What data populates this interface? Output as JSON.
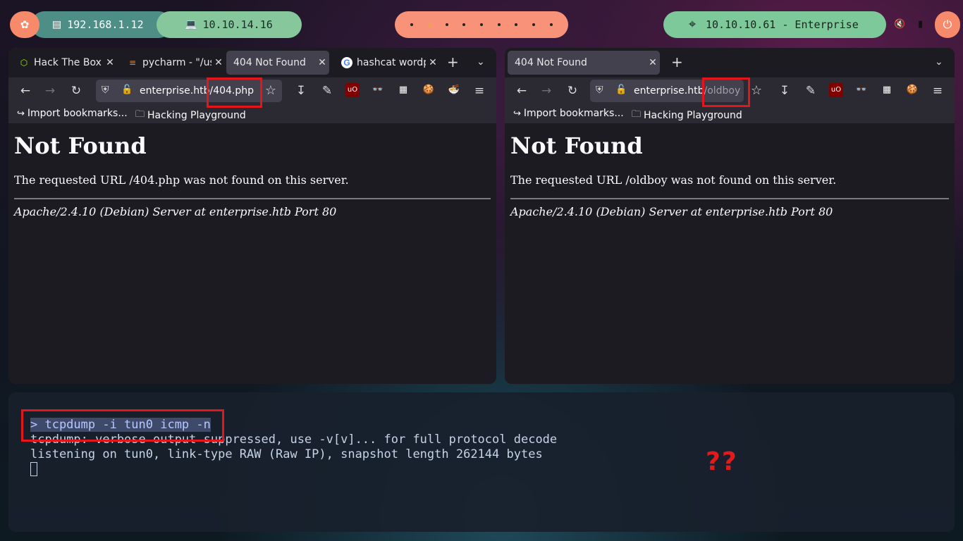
{
  "panel": {
    "kali_icon": "kali-dragon-icon",
    "local_ip": "192.168.1.12",
    "vpn_ip": "10.10.14.16",
    "workspaces": [
      "•",
      "•",
      "•",
      "•",
      "•",
      "•",
      "•",
      "•",
      "•"
    ],
    "target": "10.10.10.61 - Enterprise",
    "colors": {
      "kali": "#f88a6c",
      "local": "#4d8f86",
      "vpn": "#86c79b",
      "workspaces": "#f8937a",
      "target": "#7ec99a"
    }
  },
  "left_browser": {
    "tabs": [
      {
        "label": "Hack The Box",
        "icon": "htb-cube-icon"
      },
      {
        "label": "pycharm - \"/us",
        "icon": "stackoverflow-icon"
      },
      {
        "label": "404 Not Found",
        "icon": "",
        "active": true
      },
      {
        "label": "hashcat wordp",
        "icon": "google-icon"
      }
    ],
    "url_host": "enterprise.htb",
    "url_path": "/404.php",
    "bookmarks": [
      "Import bookmarks...",
      "Hacking Playground"
    ],
    "page": {
      "heading": "Not Found",
      "message": "The requested URL /404.php was not found on this server.",
      "footer": "Apache/2.4.10 (Debian) Server at enterprise.htb Port 80"
    }
  },
  "right_browser": {
    "tabs": [
      {
        "label": "404 Not Found",
        "active": true
      }
    ],
    "url_host": "enterprise.htb",
    "url_path": "/oldboy",
    "bookmarks": [
      "Import bookmarks...",
      "Hacking Playground"
    ],
    "page": {
      "heading": "Not Found",
      "message": "The requested URL /oldboy was not found on this server.",
      "footer": "Apache/2.4.10 (Debian) Server at enterprise.htb Port 80"
    }
  },
  "terminal": {
    "command": "> tcpdump -i tun0 icmp -n",
    "output_1": "tcpdump: verbose output suppressed, use -v[v]... for full protocol decode",
    "output_2": "listening on tun0, link-type RAW (Raw IP), snapshot length 262144 bytes"
  },
  "annotation": {
    "text": "??",
    "color": "#e21a1a"
  }
}
